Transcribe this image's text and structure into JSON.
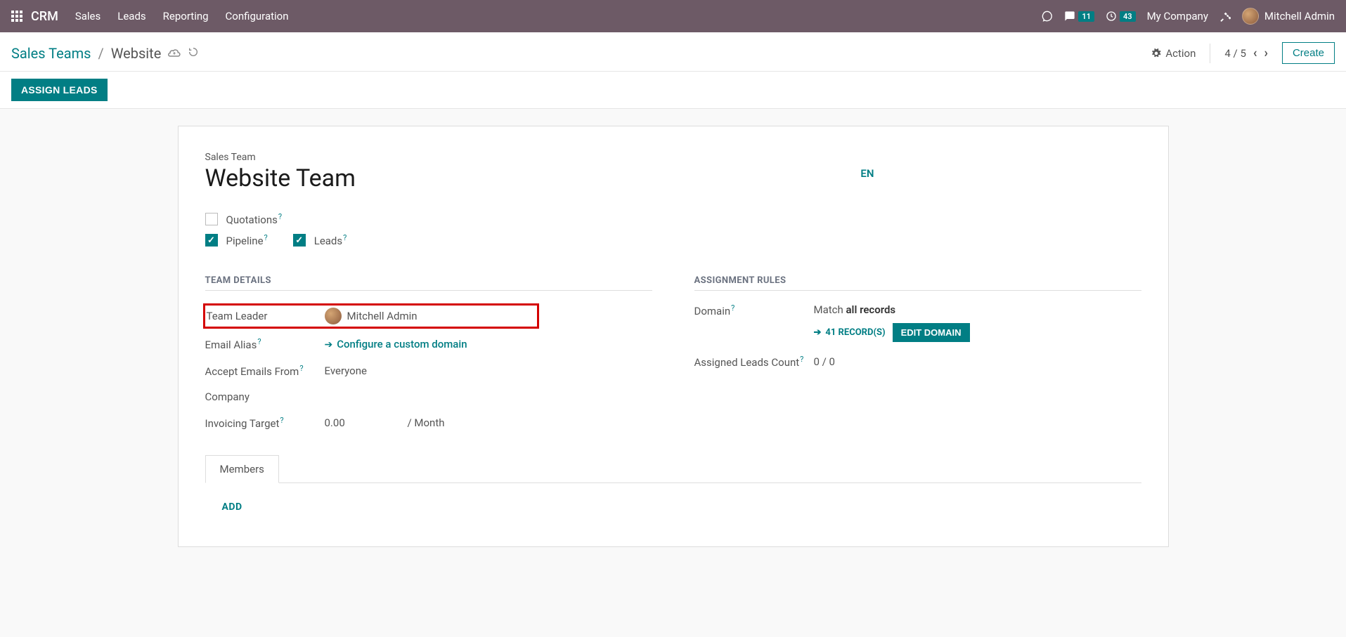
{
  "topbar": {
    "brand": "CRM",
    "nav": [
      "Sales",
      "Leads",
      "Reporting",
      "Configuration"
    ],
    "messages_badge": "11",
    "activities_badge": "43",
    "company": "My Company",
    "user": "Mitchell Admin"
  },
  "breadcrumb": {
    "parent": "Sales Teams",
    "current": "Website"
  },
  "control": {
    "action_label": "Action",
    "pager": "4 / 5",
    "create_label": "Create"
  },
  "statusbar": {
    "assign_leads": "ASSIGN LEADS"
  },
  "form": {
    "title_label": "Sales Team",
    "title_value": "Website Team",
    "lang_btn": "EN",
    "checkbox_quotations": "Quotations",
    "checkbox_pipeline": "Pipeline",
    "checkbox_leads": "Leads",
    "team_details_title": "TEAM DETAILS",
    "assignment_rules_title": "ASSIGNMENT RULES",
    "labels": {
      "team_leader": "Team Leader",
      "email_alias": "Email Alias",
      "accept_emails": "Accept Emails From",
      "company": "Company",
      "invoicing_target": "Invoicing Target",
      "domain": "Domain",
      "assigned_leads": "Assigned Leads Count"
    },
    "values": {
      "team_leader": "Mitchell Admin",
      "configure_link": "Configure a custom domain",
      "accept_emails": "Everyone",
      "invoicing_target": "0.00",
      "invoicing_unit": "/ Month",
      "domain_match_prefix": "Match ",
      "domain_match_bold": "all records",
      "records_link": "41 RECORD(S)",
      "edit_domain": "EDIT DOMAIN",
      "assigned_leads": "0 / 0"
    },
    "tabs": {
      "members": "Members"
    },
    "add_button": "ADD"
  }
}
